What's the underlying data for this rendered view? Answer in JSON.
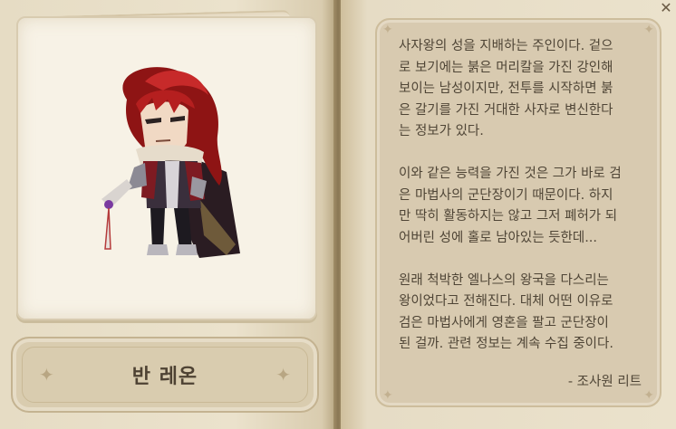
{
  "window": {
    "close_icon": "close-icon"
  },
  "portrait": {
    "character_name": "반 레온",
    "icon": "character-portrait"
  },
  "description": {
    "paragraphs": [
      "사자왕의 성을 지배하는 주인이다. 겉으\n로 보기에는 붉은 머리칼을 가진 강인해\n보이는 남성이지만, 전투를 시작하면 붉\n은 갈기를 가진 거대한 사자로 변신한다\n는 정보가 있다.",
      "이와 같은 능력을 가진 것은 그가 바로 검\n은 마법사의 군단장이기 때문이다. 하지\n만 딱히 활동하지는 않고 그저 폐허가 되\n어버린 성에 홀로 남아있는 듯한데...",
      "원래 척박한 엘나스의 왕국을 다스리는\n왕이었다고 전해진다. 대체 어떤 이유로\n검은 마법사에게 영혼을 팔고 군단장이\n된 걸까. 관련 정보는 계속 수집 중이다."
    ],
    "author": "- 조사원 리트"
  },
  "colors": {
    "page": "#ebe2cc",
    "text": "#4f4536",
    "panel": "#d8cab0"
  }
}
